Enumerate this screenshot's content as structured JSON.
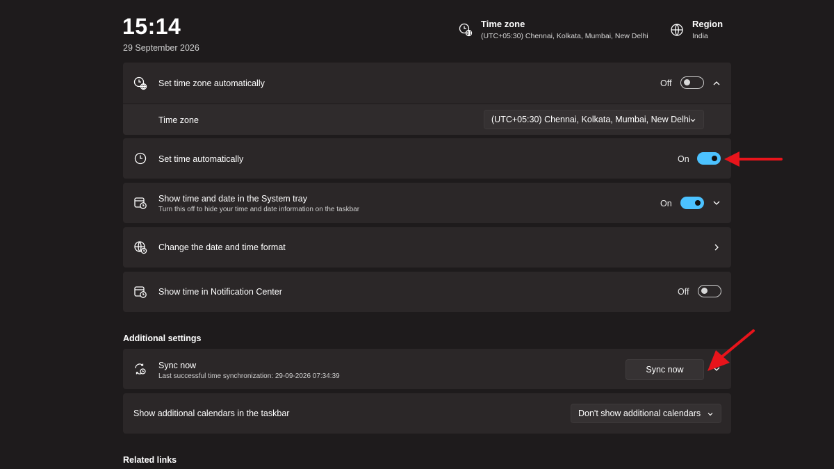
{
  "header": {
    "time": "15:14",
    "date": "29 September 2026",
    "timezone": {
      "title": "Time zone",
      "value": "(UTC+05:30) Chennai, Kolkata, Mumbai, New Delhi",
      "icon": "timezone-globe-clock-icon"
    },
    "region": {
      "title": "Region",
      "value": "India",
      "icon": "globe-icon"
    }
  },
  "settings": {
    "tz_auto": {
      "label": "Set time zone automatically",
      "state": "Off",
      "icon": "timezone-globe-clock-icon"
    },
    "tz_select": {
      "label": "Time zone",
      "value": "(UTC+05:30) Chennai, Kolkata, Mumbai, New Delhi"
    },
    "time_auto": {
      "label": "Set time automatically",
      "state": "On",
      "icon": "clock-icon"
    },
    "system_tray": {
      "label": "Show time and date in the System tray",
      "sub": "Turn this off to hide your time and date information on the taskbar",
      "state": "On",
      "icon": "calendar-clock-icon"
    },
    "format": {
      "label": "Change the date and time format",
      "icon": "globe-format-icon"
    },
    "notification": {
      "label": "Show time in Notification Center",
      "state": "Off",
      "icon": "calendar-clock-icon"
    }
  },
  "additional": {
    "title": "Additional settings",
    "sync": {
      "label": "Sync now",
      "sub": "Last successful time synchronization: 29-09-2026 07:34:39",
      "button": "Sync now",
      "icon": "sync-clock-icon"
    },
    "calendars": {
      "label": "Show additional calendars in the taskbar",
      "value": "Don't show additional calendars"
    }
  },
  "related": {
    "title": "Related links"
  },
  "colors": {
    "background": "#1e1b1c",
    "card": "#2b2728",
    "accent": "#4cc2ff",
    "arrow": "#e8141b"
  }
}
